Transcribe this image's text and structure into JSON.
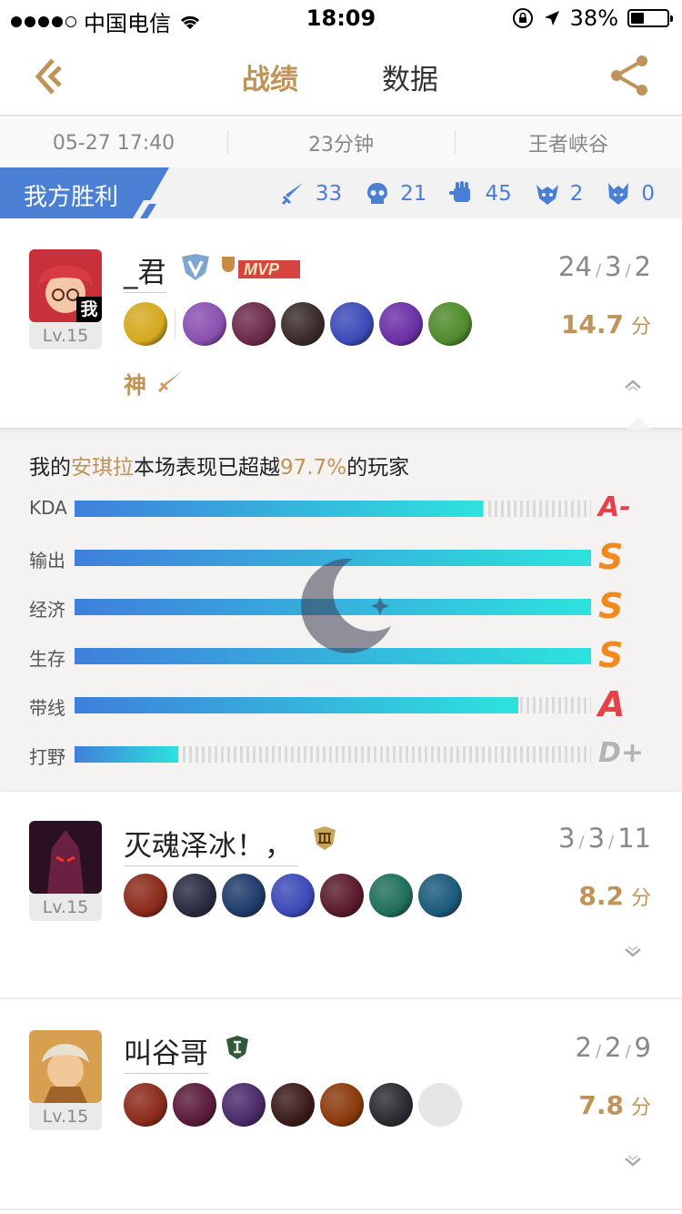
{
  "status_bar": {
    "carrier": "中国电信",
    "time": "18:09",
    "battery": "38%",
    "battery_level": 0.38
  },
  "nav": {
    "tab_record": "战绩",
    "tab_data": "数据"
  },
  "match_info": {
    "date": "05-27 17:40",
    "duration": "23分钟",
    "map": "王者峡谷"
  },
  "result": {
    "label": "我方胜利",
    "kills": "33",
    "deaths": "21",
    "assists": "45",
    "tyrants": "2",
    "overlords": "0"
  },
  "players": [
    {
      "name": "_君",
      "level": "Lv.15",
      "me_tag": "我",
      "mvp": "MVP",
      "kda": [
        "24",
        "3",
        "2"
      ],
      "score": "14.7",
      "score_unit": "分",
      "god_tag": "神",
      "item_colors": [
        "#d4a91f",
        "#8a4fb0",
        "#6b2a4a",
        "#3a2a2a",
        "#3b49b7",
        "#6a2fa5",
        "#4f8a2c"
      ]
    },
    {
      "name": "灭魂泽冰！，",
      "level": "Lv.15",
      "kda": [
        "3",
        "3",
        "11"
      ],
      "score": "8.2",
      "score_unit": "分",
      "item_colors": [
        "#8b2a1a",
        "#2a2a40",
        "#1f3a6a",
        "#3b49b7",
        "#5a1a2a",
        "#1f6f5a",
        "#1a5a7a"
      ]
    },
    {
      "name": "叫谷哥",
      "level": "Lv.15",
      "kda": [
        "2",
        "2",
        "9"
      ],
      "score": "7.8",
      "score_unit": "分",
      "item_colors": [
        "#8b2a1a",
        "#5a1a3a",
        "#4a2a6a",
        "#3a1a1a",
        "#8a3a0a",
        "#2a2a30",
        "#e8e8e8"
      ]
    }
  ],
  "performance": {
    "prefix": "我的",
    "hero": "安琪拉",
    "middle": "本场表现已超越",
    "percent": "97.7%",
    "suffix": "的玩家",
    "rows": [
      {
        "label": "KDA",
        "value": 0.79,
        "grade": "A-",
        "grade_color": "#e8404a"
      },
      {
        "label": "输出",
        "value": 1.0,
        "grade": "S",
        "grade_color": "#f08a1e"
      },
      {
        "label": "经济",
        "value": 1.0,
        "grade": "S",
        "grade_color": "#f08a1e"
      },
      {
        "label": "生存",
        "value": 1.0,
        "grade": "S",
        "grade_color": "#f08a1e"
      },
      {
        "label": "带线",
        "value": 0.86,
        "grade": "A",
        "grade_color": "#e8404a"
      },
      {
        "label": "打野",
        "value": 0.2,
        "grade": "D+",
        "grade_color": "#b3b3b3"
      }
    ]
  }
}
